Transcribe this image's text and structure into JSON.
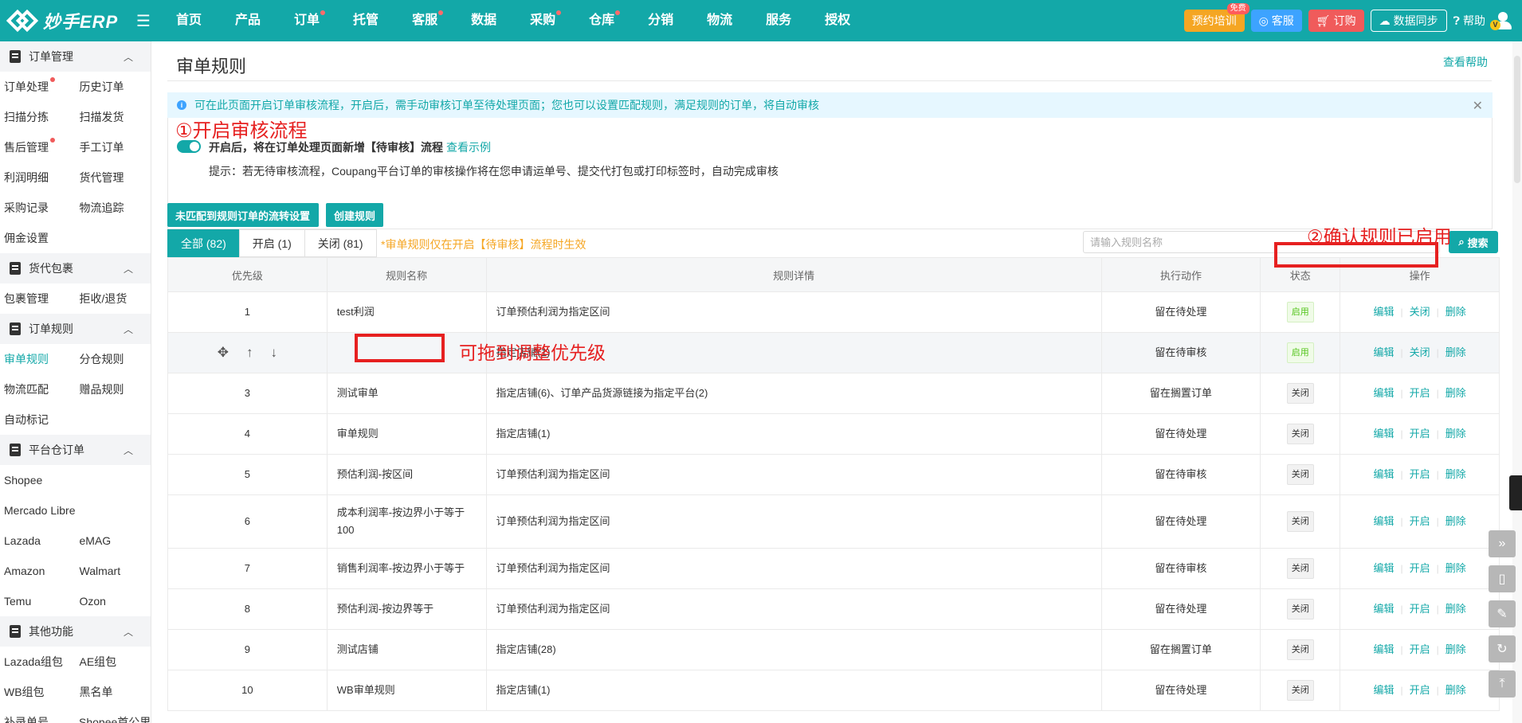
{
  "brand": {
    "name": "妙手ERP"
  },
  "topnav": {
    "items": [
      {
        "label": "首页",
        "dot": false
      },
      {
        "label": "产品",
        "dot": false
      },
      {
        "label": "订单",
        "dot": true
      },
      {
        "label": "托管",
        "dot": false
      },
      {
        "label": "客服",
        "dot": true
      },
      {
        "label": "数据",
        "dot": false
      },
      {
        "label": "采购",
        "dot": true
      },
      {
        "label": "仓库",
        "dot": true
      },
      {
        "label": "分销",
        "dot": false
      },
      {
        "label": "物流",
        "dot": false
      },
      {
        "label": "服务",
        "dot": false
      },
      {
        "label": "授权",
        "dot": false
      }
    ],
    "training": "预约培训",
    "training_badge": "免费",
    "service": "客服",
    "order": "订购",
    "sync": "数据同步",
    "help": "帮助",
    "avatar_badge": "V"
  },
  "sidebar": {
    "groups": [
      {
        "title": "订单管理",
        "rows": [
          [
            {
              "label": "订单处理",
              "dot": true
            },
            {
              "label": "历史订单"
            }
          ],
          [
            {
              "label": "扫描分拣"
            },
            {
              "label": "扫描发货"
            }
          ],
          [
            {
              "label": "售后管理",
              "dot": true
            },
            {
              "label": "手工订单"
            }
          ],
          [
            {
              "label": "利润明细"
            },
            {
              "label": "货代管理"
            }
          ],
          [
            {
              "label": "采购记录"
            },
            {
              "label": "物流追踪"
            }
          ],
          [
            {
              "label": "佣金设置"
            }
          ]
        ]
      },
      {
        "title": "货代包裹",
        "rows": [
          [
            {
              "label": "包裹管理"
            },
            {
              "label": "拒收/退货"
            }
          ]
        ]
      },
      {
        "title": "订单规则",
        "rows": [
          [
            {
              "label": "审单规则",
              "active": true
            },
            {
              "label": "分仓规则"
            }
          ],
          [
            {
              "label": "物流匹配"
            },
            {
              "label": "赠品规则"
            }
          ],
          [
            {
              "label": "自动标记"
            }
          ]
        ]
      },
      {
        "title": "平台仓订单",
        "rows": [
          [
            {
              "label": "Shopee"
            }
          ],
          [
            {
              "label": "Mercado Libre"
            }
          ],
          [
            {
              "label": "Lazada"
            },
            {
              "label": "eMAG"
            }
          ],
          [
            {
              "label": "Amazon"
            },
            {
              "label": "Walmart"
            }
          ],
          [
            {
              "label": "Temu"
            },
            {
              "label": "Ozon"
            }
          ]
        ]
      },
      {
        "title": "其他功能",
        "rows": [
          [
            {
              "label": "Lazada组包"
            },
            {
              "label": "AE组包"
            }
          ],
          [
            {
              "label": "WB组包"
            },
            {
              "label": "黑名单"
            }
          ],
          [
            {
              "label": "补录单号"
            },
            {
              "label": "Shopee首公里"
            }
          ]
        ]
      }
    ]
  },
  "page": {
    "title": "审单规则",
    "help_link": "查看帮助",
    "notice": "可在此页面开启订单审核流程，开启后，需手动审核订单至待处理页面；您也可以设置匹配规则，满足规则的订单，将自动审核",
    "annotation_1": "①开启审核流程",
    "toggle_text": "开启后，将在订单处理页面新增【待审核】流程",
    "toggle_link": "查看示例",
    "hint": "提示：若无待审核流程，Coupang平台订单的审核操作将在您申请运单号、提交代打包或打印标签时，自动完成审核",
    "btn_unmatched": "未匹配到规则订单的流转设置",
    "btn_create": "创建规则",
    "tabs": [
      {
        "label": "全部 (82)",
        "active": true
      },
      {
        "label": "开启 (1)"
      },
      {
        "label": "关闭 (81)"
      }
    ],
    "tab_note": "*审单规则仅在开启【待审核】流程时生效",
    "search_placeholder": "请输入规则名称",
    "search_btn": "搜索",
    "annotation_2": "②确认规则已启用",
    "annotation_3": "可拖到调整优先级"
  },
  "table": {
    "headers": [
      "优先级",
      "规则名称",
      "规则详情",
      "执行动作",
      "状态",
      "操作"
    ],
    "rows": [
      {
        "priority": "1",
        "name": "test利润",
        "detail": "订单预估利润为指定区间",
        "action": "留在待处理",
        "status": "启用",
        "on": true,
        "ops": [
          "编辑",
          "关闭",
          "删除"
        ],
        "h": 51
      },
      {
        "priority": "",
        "name": "",
        "detail": "指定店铺(1)",
        "action": "留在待审核",
        "status": "启用",
        "on": true,
        "ops": [
          "编辑",
          "关闭",
          "删除"
        ],
        "h": 51,
        "drag": true
      },
      {
        "priority": "3",
        "name": "测试审单",
        "detail": "指定店铺(6)、订单产品货源链接为指定平台(2)",
        "action": "留在搁置订单",
        "status": "关闭",
        "on": false,
        "ops": [
          "编辑",
          "开启",
          "删除"
        ],
        "h": 51
      },
      {
        "priority": "4",
        "name": "审单规则",
        "detail": "指定店铺(1)",
        "action": "留在待处理",
        "status": "关闭",
        "on": false,
        "ops": [
          "编辑",
          "开启",
          "删除"
        ],
        "h": 51
      },
      {
        "priority": "5",
        "name": "预估利润-按区间",
        "detail": "订单预估利润为指定区间",
        "action": "留在待审核",
        "status": "关闭",
        "on": false,
        "ops": [
          "编辑",
          "开启",
          "删除"
        ],
        "h": 51
      },
      {
        "priority": "6",
        "name": "成本利润率-按边界小于等于100",
        "detail": "订单预估利润为指定区间",
        "action": "留在待处理",
        "status": "关闭",
        "on": false,
        "ops": [
          "编辑",
          "开启",
          "删除"
        ],
        "h": 67
      },
      {
        "priority": "7",
        "name": "销售利润率-按边界小于等于",
        "detail": "订单预估利润为指定区间",
        "action": "留在待审核",
        "status": "关闭",
        "on": false,
        "ops": [
          "编辑",
          "开启",
          "删除"
        ],
        "h": 51
      },
      {
        "priority": "8",
        "name": "预估利润-按边界等于",
        "detail": "订单预估利润为指定区间",
        "action": "留在待处理",
        "status": "关闭",
        "on": false,
        "ops": [
          "编辑",
          "开启",
          "删除"
        ],
        "h": 51
      },
      {
        "priority": "9",
        "name": "测试店铺",
        "detail": "指定店铺(28)",
        "action": "留在搁置订单",
        "status": "关闭",
        "on": false,
        "ops": [
          "编辑",
          "开启",
          "删除"
        ],
        "h": 51
      },
      {
        "priority": "10",
        "name": "WB审单规则",
        "detail": "指定店铺(1)",
        "action": "留在待处理",
        "status": "关闭",
        "on": false,
        "ops": [
          "编辑",
          "开启",
          "删除"
        ],
        "h": 51
      }
    ]
  }
}
